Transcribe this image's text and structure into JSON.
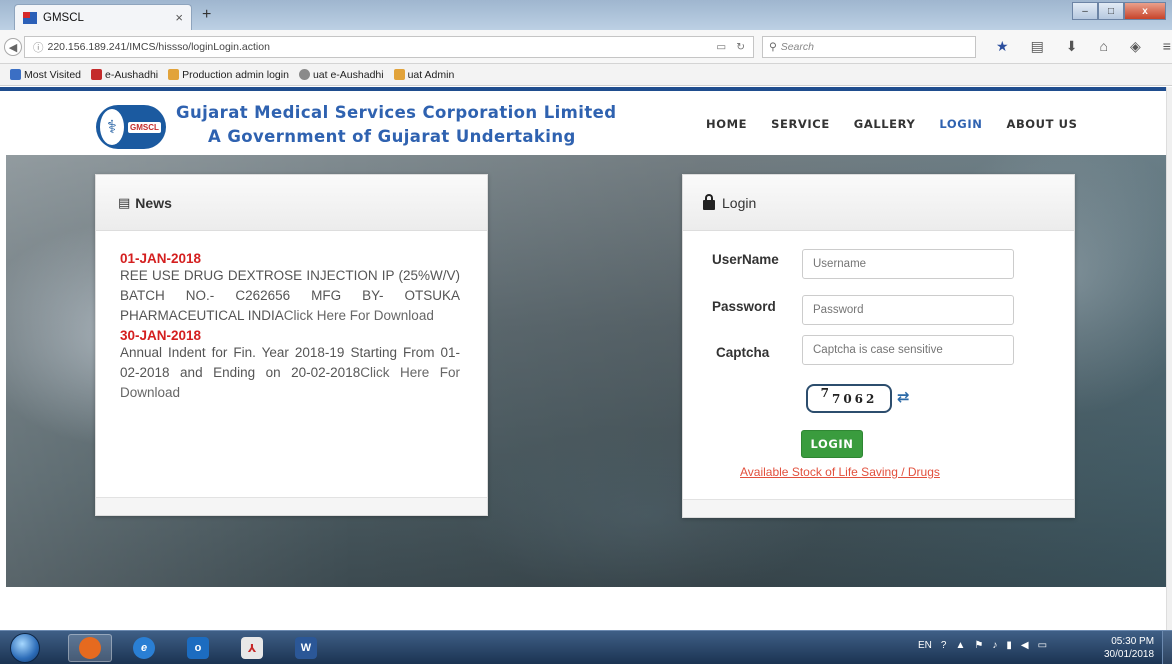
{
  "browser": {
    "tab_title": "GMSCL",
    "tab_close": "×",
    "new_tab": "+",
    "url": "220.156.189.241/IMCS/hissso/loginLogin.action",
    "search_placeholder": "Search",
    "window_buttons": [
      "–",
      "□",
      "x"
    ],
    "bookmarks": [
      {
        "label": "Most Visited",
        "color": "#3b6fc4"
      },
      {
        "label": "e-Aushadhi",
        "color": "#c42b2b"
      },
      {
        "label": "Production admin login",
        "color": "#e2a33a"
      },
      {
        "label": "uat e-Aushadhi",
        "color": "#8a8a8a"
      },
      {
        "label": "uat Admin",
        "color": "#e2a33a"
      }
    ]
  },
  "site": {
    "logo_text": "GMSCL",
    "org_name": "Gujarat Medical Services Corporation Limited",
    "org_tagline": "A Government of Gujarat Undertaking",
    "menu": [
      "HOME",
      "SERVICE",
      "GALLERY",
      "LOGIN",
      "ABOUT US"
    ],
    "active_menu": "LOGIN",
    "brand_color": "#2f62b0"
  },
  "news": {
    "title": "News",
    "items": [
      {
        "date": "01-JAN-2018",
        "text": "REE USE DRUG DEXTROSE INJECTION IP (25%W/V) BATCH NO.- C262656 MFG BY- OTSUKA PHARMACEUTICAL INDIA",
        "link": "Click Here For Download"
      },
      {
        "date": "30-JAN-2018",
        "text": "Annual Indent for Fin. Year 2018-19 Starting From 01-02-2018 and Ending on 20-02-2018",
        "link": "Click Here For Download"
      }
    ]
  },
  "login": {
    "title": "Login",
    "username_label": "UserName",
    "username_placeholder": "Username",
    "password_label": "Password",
    "password_placeholder": "Password",
    "captcha_label": "Captcha",
    "captcha_placeholder": "Captcha is case sensitive",
    "captcha_sup": "7",
    "captcha_code": "7062",
    "submit": "LOGIN",
    "stock_link": "Available Stock of Life Saving / Drugs"
  },
  "taskbar": {
    "tray_lang": "EN",
    "time": "05:30 PM",
    "date": "30/01/2018"
  }
}
